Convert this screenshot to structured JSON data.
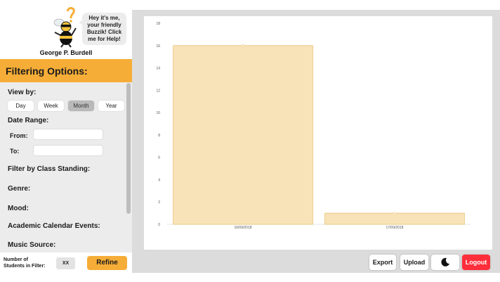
{
  "mascot": {
    "bubble_lines": [
      "Hey it's me,",
      "your friendly",
      "Buzzik! Click",
      "me for Help!"
    ],
    "user_name": "George P. Burdell"
  },
  "filters": {
    "header": "Filtering Options:",
    "view_by_label": "View by:",
    "view_options": [
      "Day",
      "Week",
      "Month",
      "Year"
    ],
    "view_selected": "Month",
    "date_range_label": "Date Range:",
    "from_label": "From:",
    "to_label": "To:",
    "from_value": "",
    "to_value": "",
    "class_standing_label": "Filter by Class Standing:",
    "genre_label": "Genre:",
    "mood_label": "Mood:",
    "academic_label": "Academic Calendar Events:",
    "music_source_label": "Music Source:"
  },
  "footer": {
    "students_label_line1": "Number of",
    "students_label_line2": "Students in Filter:",
    "count": "XX",
    "refine": "Refine"
  },
  "actions": {
    "export": "Export",
    "upload": "Upload",
    "dark_mode_icon": "moon-icon",
    "logout": "Logout"
  },
  "colors": {
    "accent": "#f6ad37",
    "logout": "#ff2e3b",
    "bar_fill": "#f8e3b8",
    "bar_stroke": "#e8c173"
  },
  "chart_data": {
    "type": "bar",
    "categories": [
      "16/09/2018",
      "17/09/2018"
    ],
    "values": [
      16,
      1
    ],
    "ylim": [
      0,
      18
    ],
    "yticks": [
      "0",
      "2",
      "4",
      "6",
      "8",
      "10",
      "12",
      "14",
      "16",
      "18"
    ],
    "grid": false,
    "title": "",
    "xlabel": "",
    "ylabel": ""
  }
}
